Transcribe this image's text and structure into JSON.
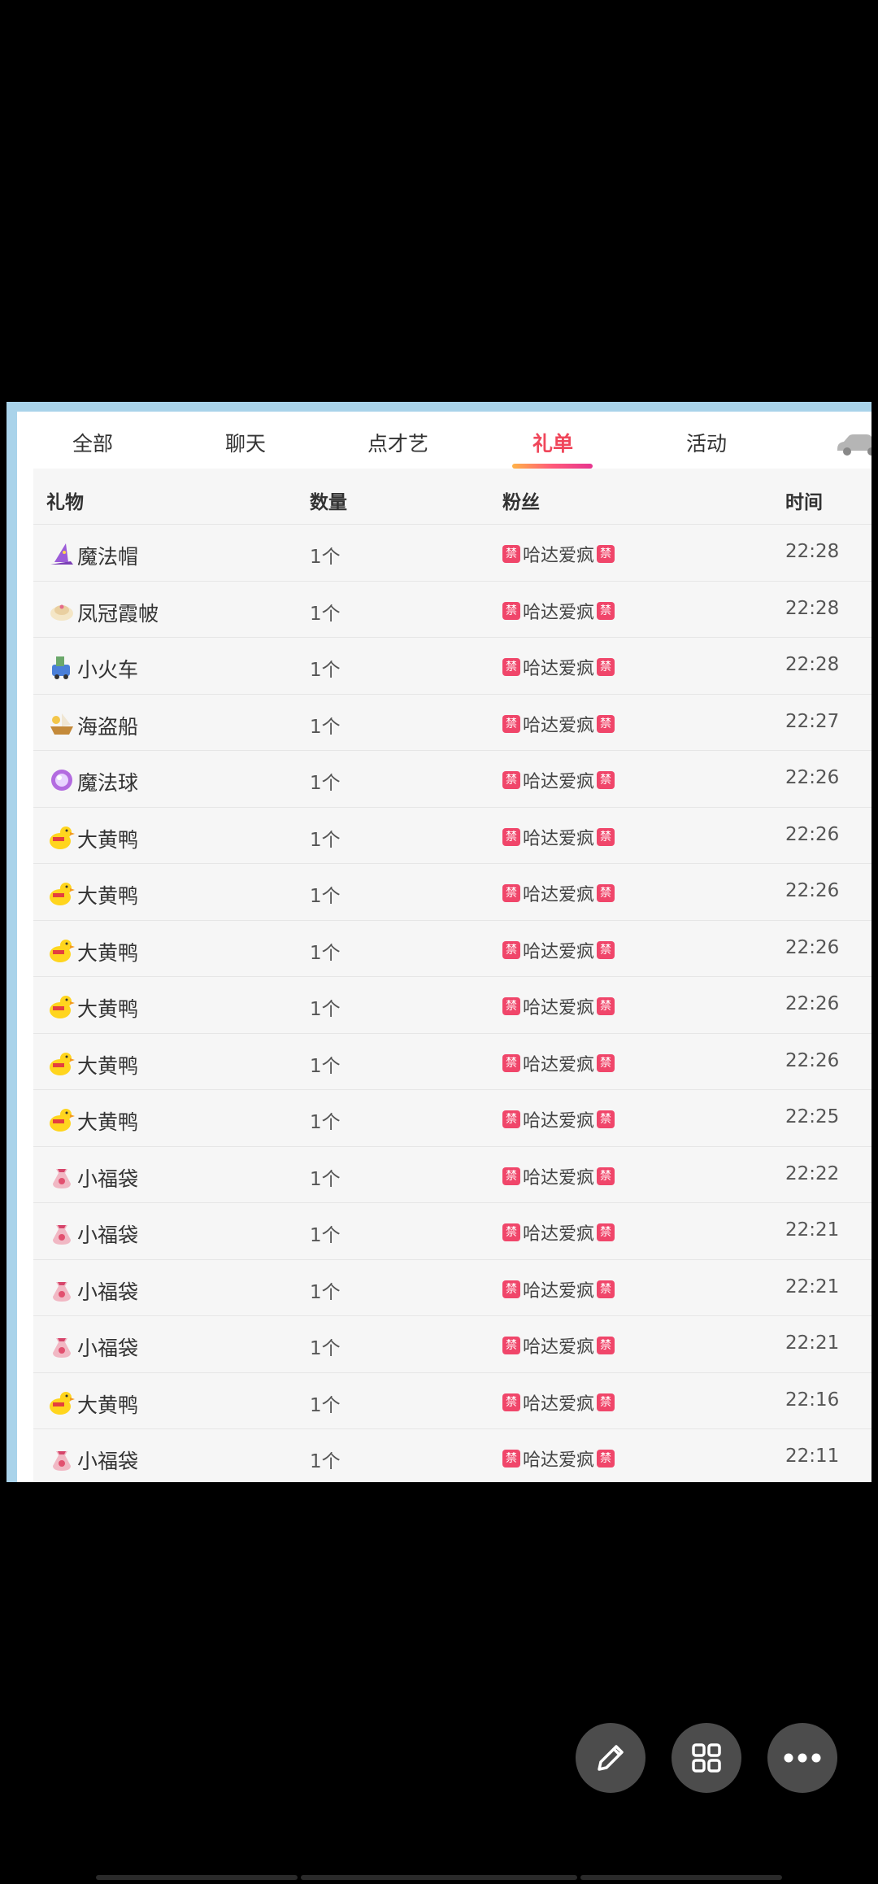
{
  "tabs": [
    {
      "label": "全部"
    },
    {
      "label": "聊天"
    },
    {
      "label": "点才艺"
    },
    {
      "label": "礼单",
      "active": true
    },
    {
      "label": "活动"
    }
  ],
  "table": {
    "headers": {
      "gift": "礼物",
      "qty": "数量",
      "fan": "粉丝",
      "time": "时间"
    },
    "badge_text": "禁",
    "rows": [
      {
        "gift": "魔法帽",
        "icon": "magic-hat-icon",
        "qty": "1个",
        "fan": "哈达爱疯",
        "time": "22:28"
      },
      {
        "gift": "凤冠霞帔",
        "icon": "phoenix-crown-icon",
        "qty": "1个",
        "fan": "哈达爱疯",
        "time": "22:28"
      },
      {
        "gift": "小火车",
        "icon": "train-icon",
        "qty": "1个",
        "fan": "哈达爱疯",
        "time": "22:28"
      },
      {
        "gift": "海盗船",
        "icon": "pirate-ship-icon",
        "qty": "1个",
        "fan": "哈达爱疯",
        "time": "22:27"
      },
      {
        "gift": "魔法球",
        "icon": "magic-ball-icon",
        "qty": "1个",
        "fan": "哈达爱疯",
        "time": "22:26"
      },
      {
        "gift": "大黄鸭",
        "icon": "yellow-duck-icon",
        "qty": "1个",
        "fan": "哈达爱疯",
        "time": "22:26"
      },
      {
        "gift": "大黄鸭",
        "icon": "yellow-duck-icon",
        "qty": "1个",
        "fan": "哈达爱疯",
        "time": "22:26"
      },
      {
        "gift": "大黄鸭",
        "icon": "yellow-duck-icon",
        "qty": "1个",
        "fan": "哈达爱疯",
        "time": "22:26"
      },
      {
        "gift": "大黄鸭",
        "icon": "yellow-duck-icon",
        "qty": "1个",
        "fan": "哈达爱疯",
        "time": "22:26"
      },
      {
        "gift": "大黄鸭",
        "icon": "yellow-duck-icon",
        "qty": "1个",
        "fan": "哈达爱疯",
        "time": "22:26"
      },
      {
        "gift": "大黄鸭",
        "icon": "yellow-duck-icon",
        "qty": "1个",
        "fan": "哈达爱疯",
        "time": "22:25"
      },
      {
        "gift": "小福袋",
        "icon": "lucky-bag-icon",
        "qty": "1个",
        "fan": "哈达爱疯",
        "time": "22:22"
      },
      {
        "gift": "小福袋",
        "icon": "lucky-bag-icon",
        "qty": "1个",
        "fan": "哈达爱疯",
        "time": "22:21"
      },
      {
        "gift": "小福袋",
        "icon": "lucky-bag-icon",
        "qty": "1个",
        "fan": "哈达爱疯",
        "time": "22:21"
      },
      {
        "gift": "小福袋",
        "icon": "lucky-bag-icon",
        "qty": "1个",
        "fan": "哈达爱疯",
        "time": "22:21"
      },
      {
        "gift": "大黄鸭",
        "icon": "yellow-duck-icon",
        "qty": "1个",
        "fan": "哈达爱疯",
        "time": "22:16"
      },
      {
        "gift": "小福袋",
        "icon": "lucky-bag-icon",
        "qty": "1个",
        "fan": "哈达爱疯",
        "time": "22:11"
      }
    ]
  },
  "colors": {
    "accent": "#f0465a",
    "panel_border": "#a9d3ea",
    "fab": "#4c4c4c"
  },
  "fab_buttons": [
    {
      "icon": "pencil-icon"
    },
    {
      "icon": "grid-icon"
    },
    {
      "icon": "more-dots-icon"
    }
  ]
}
